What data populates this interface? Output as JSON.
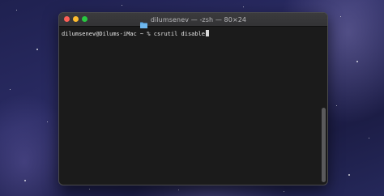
{
  "window": {
    "title": "dilumsenev — -zsh — 80×24",
    "icon": "folder-icon",
    "traffic_lights": [
      "close",
      "minimize",
      "zoom"
    ]
  },
  "terminal": {
    "prompt": "dilumsenev@Dilums-iMac ~ % ",
    "command": "csrutil disable"
  },
  "colors": {
    "close": "#fe5f57",
    "minimize": "#febc2e",
    "zoom": "#28c840",
    "terminal_bg": "#1b1b1b",
    "folder": "#5aa9e6"
  }
}
